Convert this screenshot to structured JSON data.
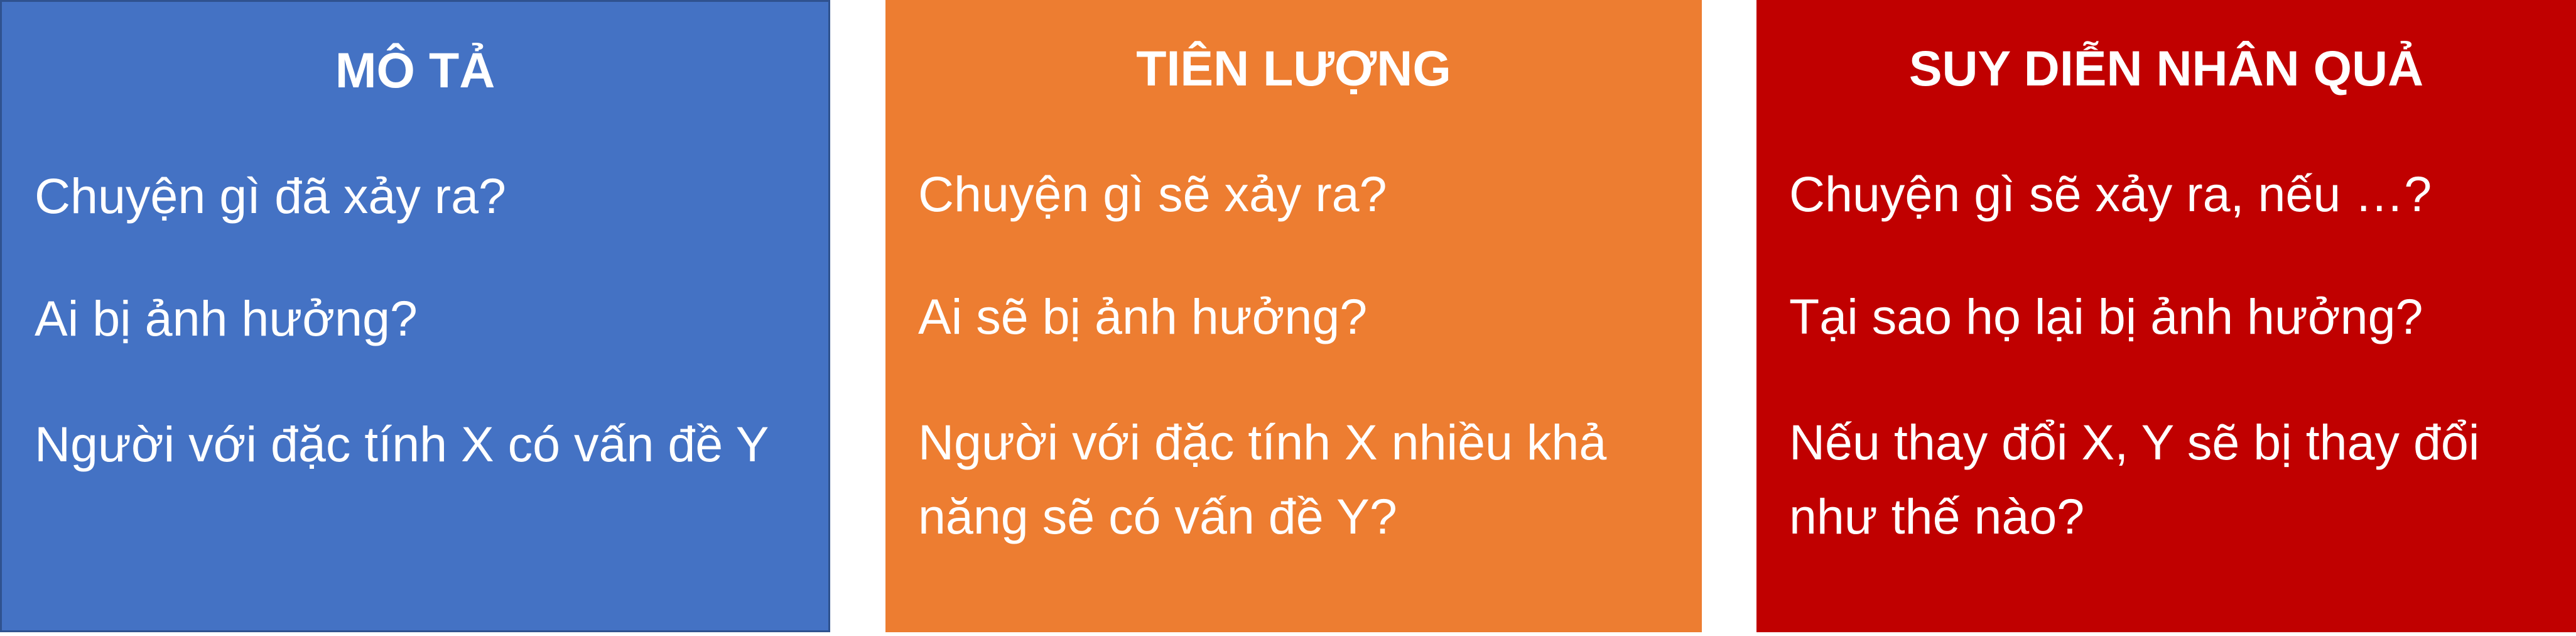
{
  "panels": [
    {
      "title": "MÔ TẢ",
      "color": "#4472c4",
      "lines": [
        "Chuyện gì đã xảy ra?",
        "Ai bị ảnh hưởng?",
        "Người với đặc tính X có vấn đề Y"
      ]
    },
    {
      "title": "TIÊN LƯỢNG",
      "color": "#ed7d31",
      "lines": [
        "Chuyện gì sẽ xảy ra?",
        "Ai sẽ bị ảnh hưởng?",
        "Người với đặc tính X nhiều khả năng sẽ có vấn đề Y?"
      ]
    },
    {
      "title": "SUY DIỄN NHÂN QUẢ",
      "color": "#c00000",
      "lines": [
        "Chuyện gì sẽ xảy ra, nếu …?",
        "Tại sao họ lại bị ảnh hưởng?",
        "Nếu thay đổi X, Y sẽ bị thay đổi như thế nào?"
      ]
    }
  ]
}
